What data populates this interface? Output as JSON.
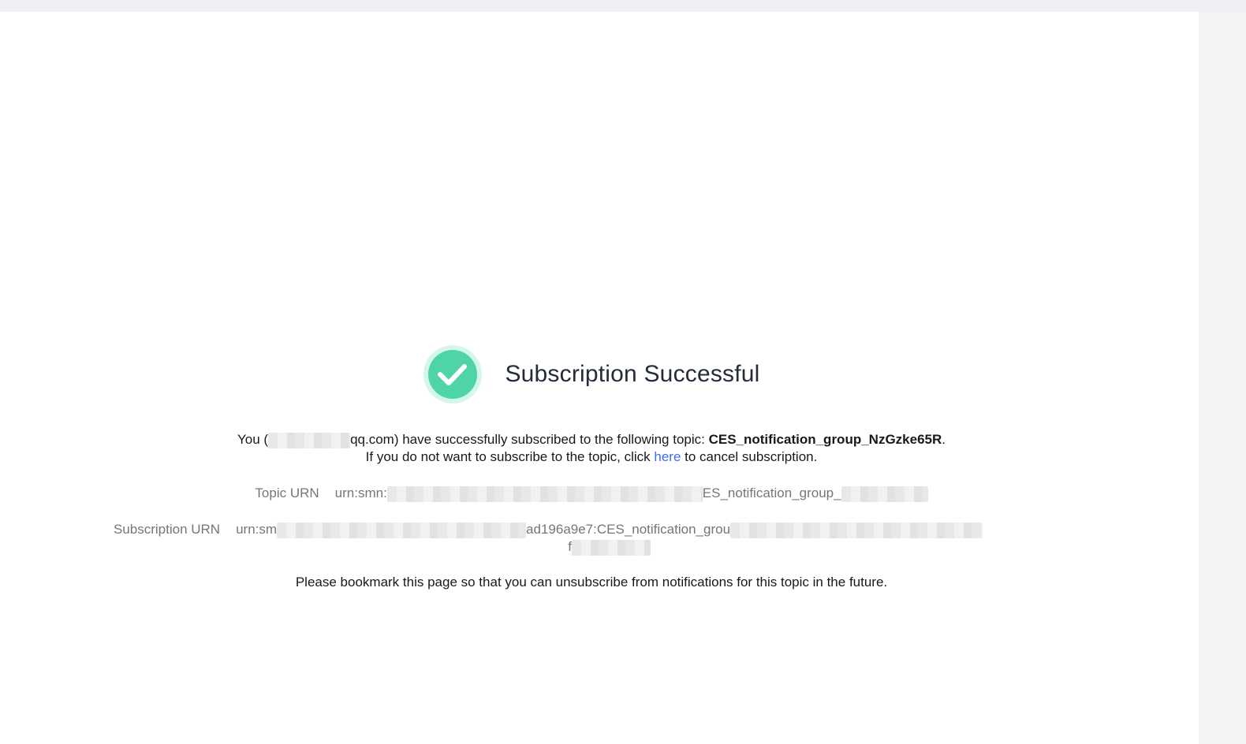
{
  "title": "Subscription Successful",
  "icons": {
    "success": "check-circle-icon"
  },
  "colors": {
    "success_green": "#4fd4a7",
    "link_blue": "#3f6ee8"
  },
  "message": {
    "prefix": "You (",
    "email_visible": "qq.com",
    "middle": ") have successfully subscribed to the following topic: ",
    "topic_name": "CES_notification_group_NzGzke65R",
    "suffix": ".",
    "line2_prefix": "If you do not want to subscribe to the topic, click ",
    "link_text": "here",
    "line2_suffix": " to cancel subscription."
  },
  "topic_urn": {
    "label": "Topic URN",
    "value_start": "urn:smn:",
    "value_end": "ES_notification_group_"
  },
  "subscription_urn": {
    "label": "Subscription URN",
    "value_start": "urn:sm",
    "value_mid": "ad196a9e7:CES_notification_grou",
    "value_line2": "f"
  },
  "bookmark_note": "Please bookmark this page so that you can unsubscribe from notifications for this topic in the future."
}
